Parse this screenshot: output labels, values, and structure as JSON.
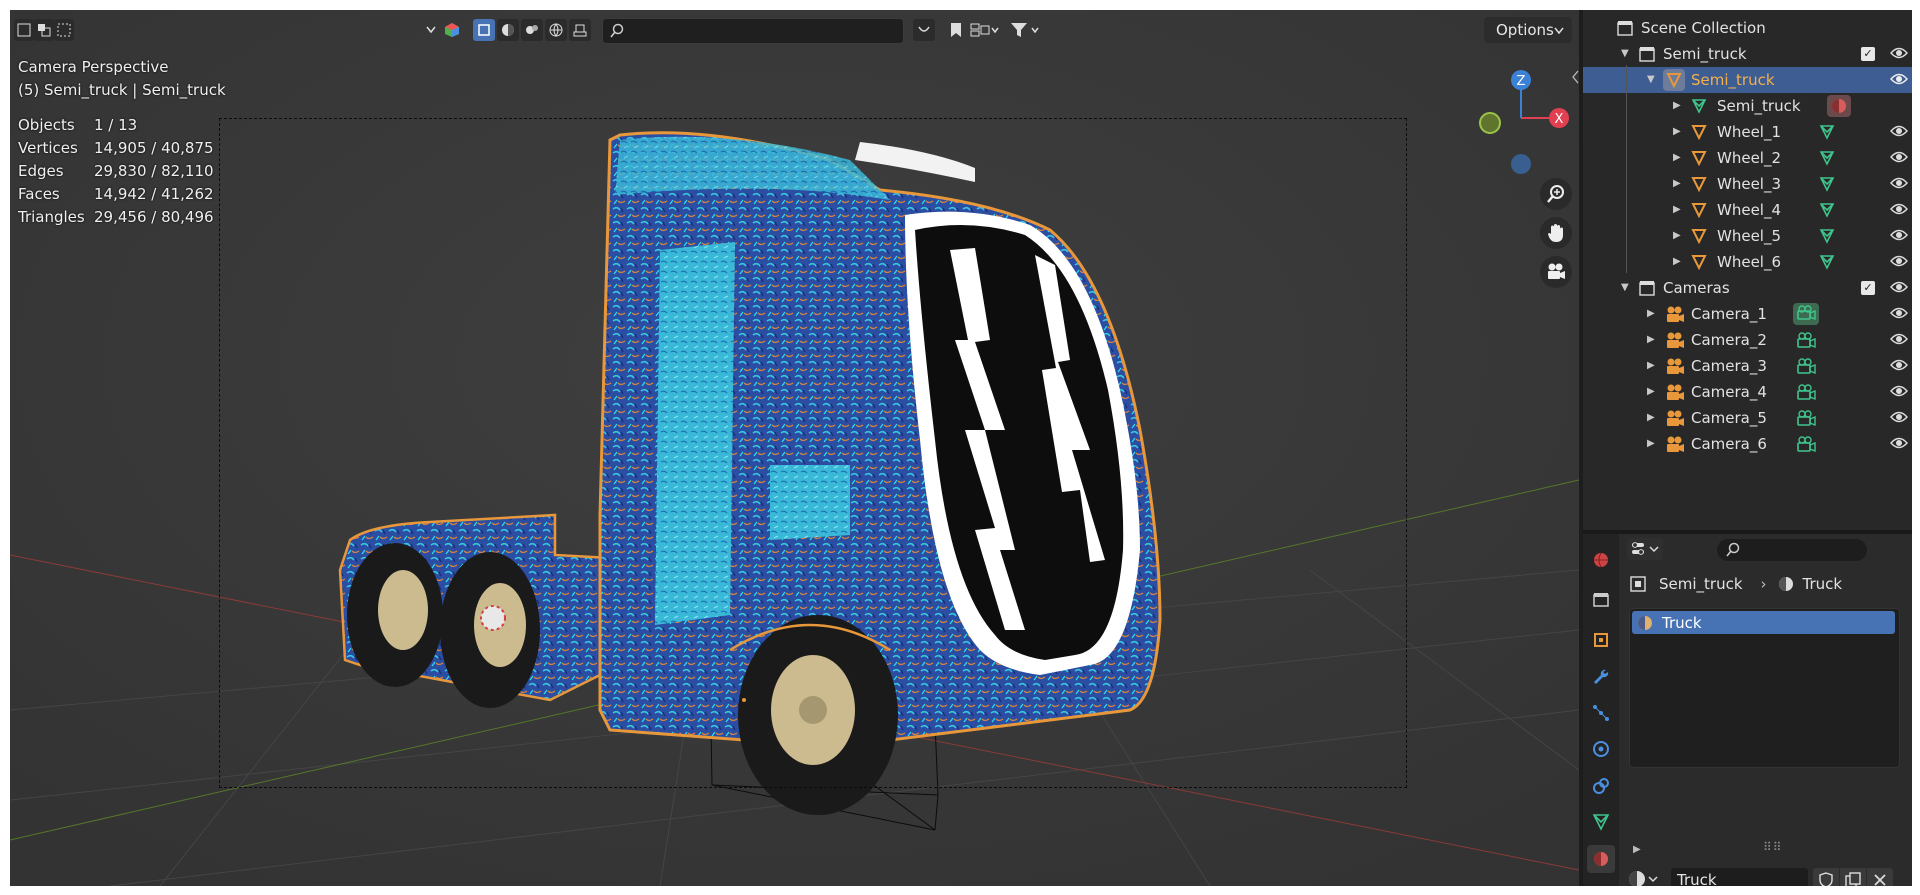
{
  "viewport": {
    "header": {
      "options_label": "Options",
      "search_placeholder": ""
    },
    "overlay": {
      "title": "Camera Perspective",
      "subtitle": "(5) Semi_truck | Semi_truck",
      "stats": [
        {
          "label": "Objects",
          "value": "1 / 13"
        },
        {
          "label": "Vertices",
          "value": "14,905 / 40,875"
        },
        {
          "label": "Edges",
          "value": "29,830 / 82,110"
        },
        {
          "label": "Faces",
          "value": "14,942 / 41,262"
        },
        {
          "label": "Triangles",
          "value": "29,456 / 80,496"
        }
      ]
    },
    "gizmo": {
      "z": "Z",
      "x": "X"
    }
  },
  "outliner": {
    "root": "Scene Collection",
    "rows": [
      {
        "label": "Semi_truck",
        "icon": "collection-icon"
      },
      {
        "label": "Semi_truck",
        "icon": "object-icon"
      },
      {
        "label": "Semi_truck",
        "icon": "mesh-data-icon"
      },
      {
        "label": "Wheel_1",
        "icon": "object-icon"
      },
      {
        "label": "Wheel_2",
        "icon": "object-icon"
      },
      {
        "label": "Wheel_3",
        "icon": "object-icon"
      },
      {
        "label": "Wheel_4",
        "icon": "object-icon"
      },
      {
        "label": "Wheel_5",
        "icon": "object-icon"
      },
      {
        "label": "Wheel_6",
        "icon": "object-icon"
      },
      {
        "label": "Cameras",
        "icon": "collection-icon"
      },
      {
        "label": "Camera_1",
        "icon": "camera-icon"
      },
      {
        "label": "Camera_2",
        "icon": "camera-icon"
      },
      {
        "label": "Camera_3",
        "icon": "camera-icon"
      },
      {
        "label": "Camera_4",
        "icon": "camera-icon"
      },
      {
        "label": "Camera_5",
        "icon": "camera-icon"
      },
      {
        "label": "Camera_6",
        "icon": "camera-icon"
      }
    ]
  },
  "properties": {
    "breadcrumb_object": "Semi_truck",
    "breadcrumb_material": "Truck",
    "material_slot": "Truck",
    "material_field": "Truck"
  },
  "colors": {
    "accent": "#4772b3",
    "object_orange": "#e8983a",
    "data_green": "#3fc58c",
    "axis_x": "#e0404f",
    "axis_z": "#3b82d6",
    "axis_y": "#7ba02a"
  }
}
